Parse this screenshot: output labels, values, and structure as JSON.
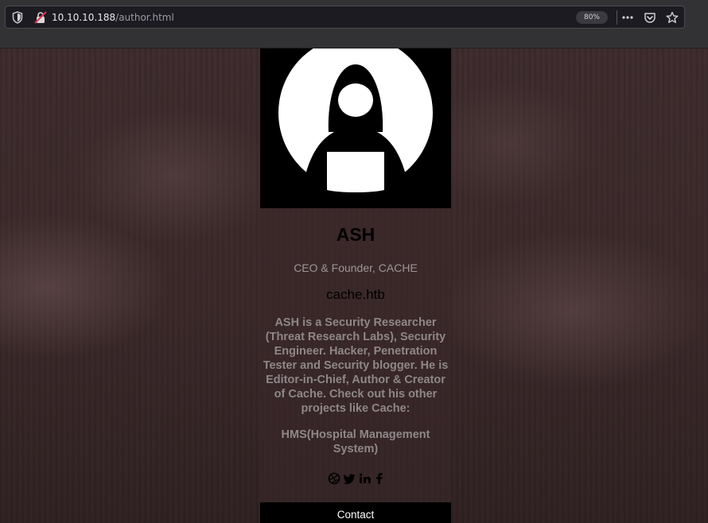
{
  "browser": {
    "url_host": "10.10.10.188",
    "url_path": "/author.html",
    "zoom": "80%"
  },
  "profile": {
    "name": "ASH",
    "title": "CEO & Founder, CACHE",
    "site": "cache.htb",
    "bio": "ASH is a Security Researcher (Threat Research Labs), Security Engineer. Hacker, Penetration Tester and Security blogger. He is Editor-in-Chief, Author & Creator of Cache. Check out his other projects like Cache:",
    "project": "HMS(Hospital Management System)",
    "contact_label": "Contact"
  },
  "icons": {
    "social": [
      "dribbble-icon",
      "twitter-icon",
      "linkedin-icon",
      "facebook-icon"
    ]
  },
  "colors": {
    "background": "#3a2829",
    "name_text": "#000000",
    "muted_text": "#8e8789",
    "contact_button": "#000000"
  }
}
